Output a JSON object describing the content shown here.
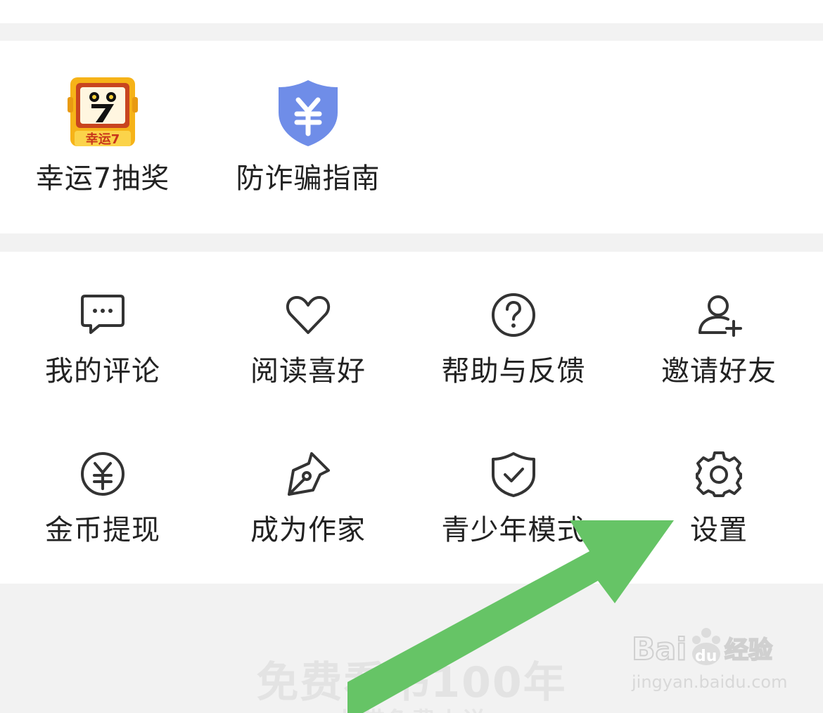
{
  "promo": [
    {
      "label": "幸运7抽奖",
      "icon": "lucky-seven-icon",
      "badge_text": "幸运7"
    },
    {
      "label": "防诈骗指南",
      "icon": "anti-fraud-shield-icon"
    }
  ],
  "menu": [
    {
      "label": "我的评论",
      "icon": "comment-icon"
    },
    {
      "label": "阅读喜好",
      "icon": "heart-icon"
    },
    {
      "label": "帮助与反馈",
      "icon": "help-icon"
    },
    {
      "label": "邀请好友",
      "icon": "add-user-icon"
    },
    {
      "label": "金币提现",
      "icon": "coin-withdraw-icon"
    },
    {
      "label": "成为作家",
      "icon": "pen-icon"
    },
    {
      "label": "青少年模式",
      "icon": "shield-check-icon"
    },
    {
      "label": "设置",
      "icon": "gear-icon"
    }
  ],
  "footer": {
    "slogan": "免费看书100年",
    "sub": "七猫免费小说"
  },
  "watermark": {
    "logo_text": "Bai du 经验",
    "url": "jingyan.baidu.com"
  },
  "colors": {
    "text": "#222222",
    "icon_stroke": "#333333",
    "shield_blue": "#6f8de8",
    "annotation_arrow": "#66c466",
    "page_bg": "#f2f2f2"
  }
}
